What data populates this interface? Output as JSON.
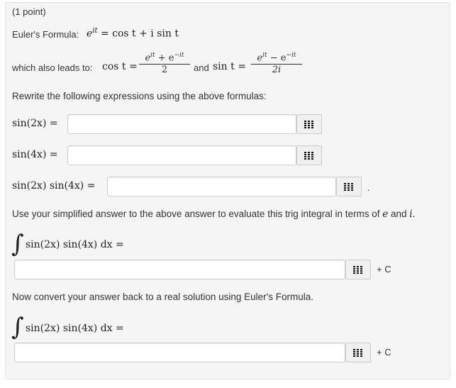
{
  "points": "(1 point)",
  "euler_label": "Euler's Formula:",
  "euler_formula": "e",
  "euler_sup": "it",
  "euler_rhs": " = cos t + i sin t",
  "leads_label": "which also leads to:",
  "cos_lhs": "cos t =",
  "cos_num": "e",
  "cos_num_sup1": "it",
  "cos_num_mid": " + e",
  "cos_num_sup2": "−it",
  "cos_den": "2",
  "and_label": "and",
  "sin_lhs": "sin t =",
  "sin_num": "e",
  "sin_num_sup1": "it",
  "sin_num_mid": " − e",
  "sin_num_sup2": "−it",
  "sin_den": "2i",
  "instruction": "Rewrite the following expressions using the above formulas:",
  "q1_label": "sin(2x) =",
  "q2_label": "sin(4x) =",
  "q3_label": "sin(2x) sin(4x) =",
  "q3_trailing": ".",
  "evaluate_prompt_start": "Use your simplified answer to the above answer to evaluate this trig integral in terms of ",
  "evaluate_prompt_e": "e",
  "evaluate_prompt_and": " and ",
  "evaluate_prompt_i": "i",
  "evaluate_prompt_end": ".",
  "integral_symbol": "∫",
  "integral_expr": "sin(2x) sin(4x) dx =",
  "plus_c": "+ C",
  "convert_prompt": "Now convert your answer back to a real solution using Euler's Formula.",
  "inputs": {
    "q1_value": "",
    "q2_value": "",
    "q3_value": "",
    "complex_answer_value": "",
    "real_answer_value": ""
  },
  "icons": {
    "palette": "grid-icon"
  }
}
